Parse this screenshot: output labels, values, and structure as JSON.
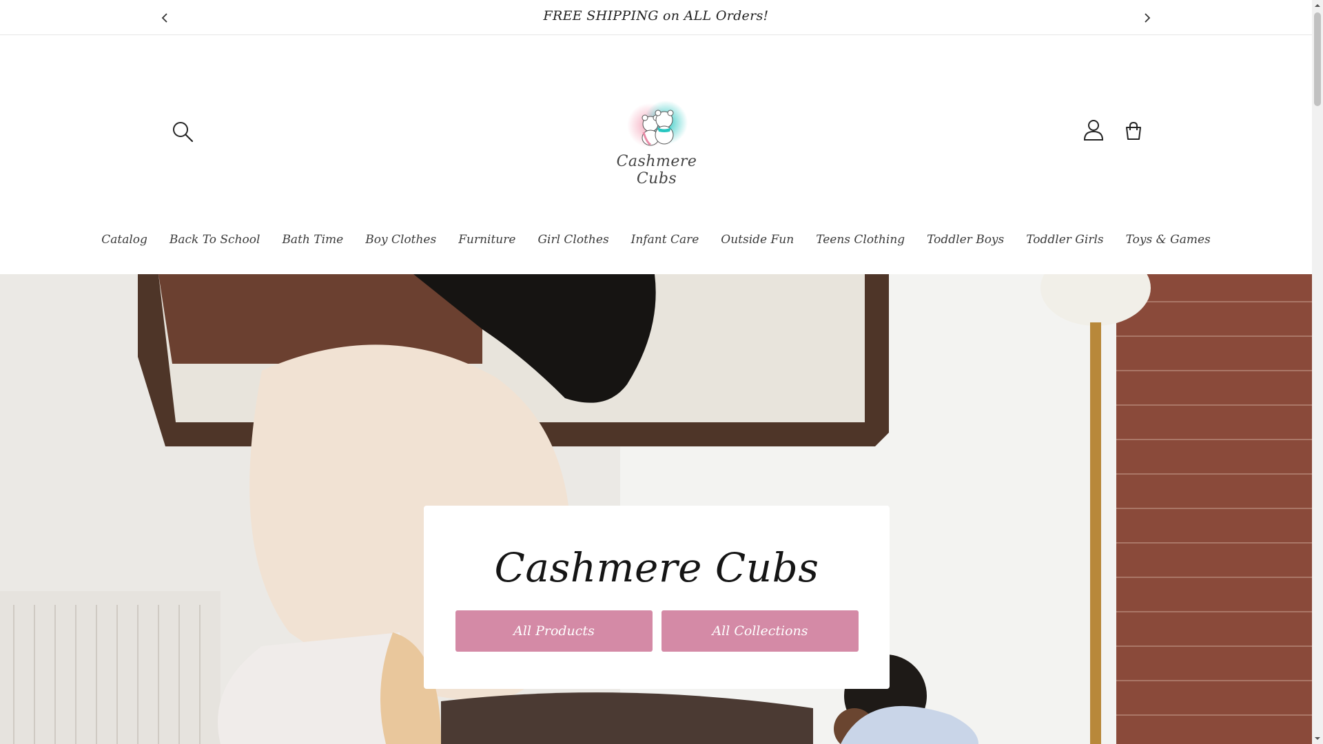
{
  "announcement": {
    "text": "FREE SHIPPING on ALL Orders!",
    "prev_icon": "chevron-left-icon",
    "next_icon": "chevron-right-icon"
  },
  "header": {
    "logo_text": "Cashmere Cubs",
    "icons": [
      "search-icon",
      "account-icon",
      "cart-icon"
    ]
  },
  "nav": {
    "items": [
      {
        "label": "Catalog"
      },
      {
        "label": "Back To School"
      },
      {
        "label": "Bath Time"
      },
      {
        "label": "Boy Clothes"
      },
      {
        "label": "Furniture"
      },
      {
        "label": "Girl Clothes"
      },
      {
        "label": "Infant Care"
      },
      {
        "label": "Outside Fun"
      },
      {
        "label": "Teens Clothing"
      },
      {
        "label": "Toddler Boys"
      },
      {
        "label": "Toddler Girls"
      },
      {
        "label": "Toys & Games"
      }
    ]
  },
  "hero": {
    "title": "Cashmere Cubs",
    "button_primary": "All Products",
    "button_secondary": "All Collections"
  },
  "colors": {
    "button": "#d48aa6",
    "logo_pink": "#f4a3b8",
    "logo_teal": "#27c6c0"
  }
}
